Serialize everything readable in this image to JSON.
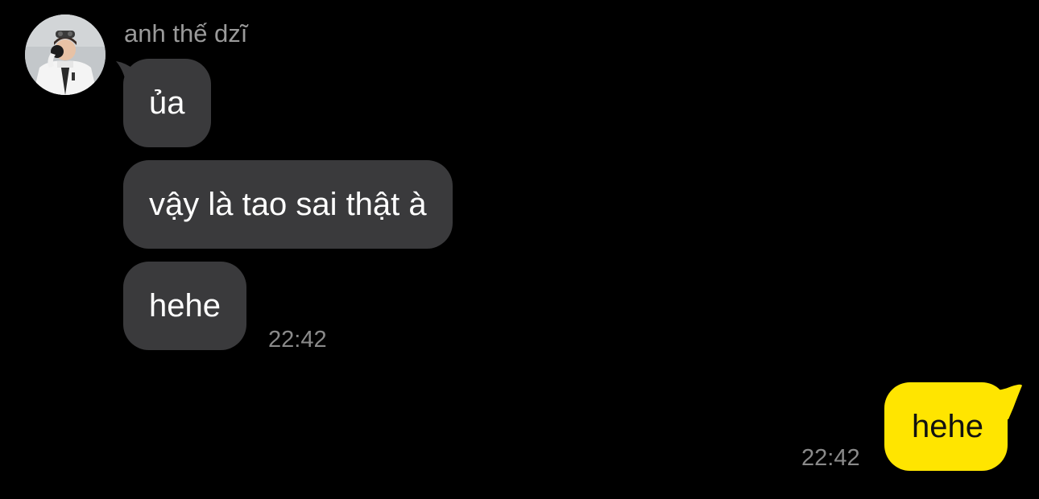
{
  "conversation": {
    "sender": {
      "name": "anh thế dzĩ",
      "avatar_icon": "profile-photo"
    },
    "incoming": [
      {
        "text": "ủa"
      },
      {
        "text": "vậy là tao sai thật à"
      },
      {
        "text": "hehe"
      }
    ],
    "incoming_time": "22:42",
    "outgoing": [
      {
        "text": "hehe"
      }
    ],
    "outgoing_time": "22:42"
  },
  "colors": {
    "background": "#000000",
    "incoming_bubble": "#3a3a3c",
    "outgoing_bubble": "#ffe500",
    "timestamp": "#8a8a8a",
    "sender_name": "#9a9a9a"
  }
}
